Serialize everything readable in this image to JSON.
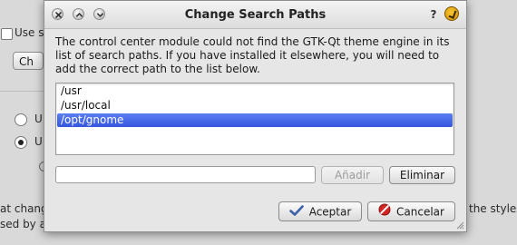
{
  "background": {
    "use_label": "Use st",
    "button_label": "Ch",
    "radio1_label": "U",
    "radio2_label": "U",
    "bottom_text_1": "at chang",
    "bottom_text_2": "sed by ap",
    "right_text": "the styles"
  },
  "dialog": {
    "title": "Change Search Paths",
    "help_label": "?",
    "message": "The control center module could not find the GTK-Qt theme engine in its list of search paths.  If you have installed it elsewhere, you will need to add the correct path to the list below.",
    "paths": [
      "/usr",
      "/usr/local",
      "/opt/gnome"
    ],
    "selected_index": 2,
    "path_input_value": "",
    "add_label": "Añadir",
    "remove_label": "Eliminar",
    "ok_label": "Aceptar",
    "cancel_label": "Cancelar"
  },
  "colors": {
    "selection": "#3f62e4",
    "dialog_bg": "#e6e6e6"
  },
  "icons": {
    "close": "close-icon",
    "minimize": "minimize-icon",
    "maximize": "maximize-icon",
    "help": "help-icon",
    "app": "app-icon",
    "ok": "checkmark-icon",
    "cancel": "cancel-icon"
  }
}
